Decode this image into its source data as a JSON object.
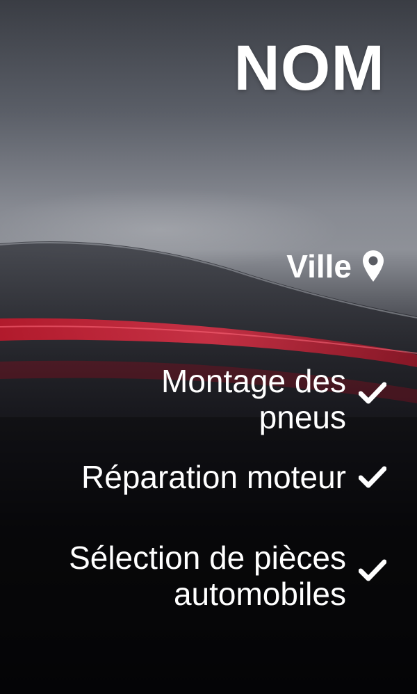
{
  "header": {
    "title": "NOM"
  },
  "location": {
    "label": "Ville",
    "icon": "map-pin-icon"
  },
  "services": [
    {
      "label": "Montage des pneus",
      "icon": "checkmark-icon"
    },
    {
      "label": "Réparation moteur",
      "icon": "checkmark-icon"
    },
    {
      "label": "Sélection de pièces automobiles",
      "icon": "checkmark-icon"
    }
  ],
  "colors": {
    "accent_red": "#c0182b",
    "text": "#ffffff",
    "background_dark": "#050507"
  }
}
